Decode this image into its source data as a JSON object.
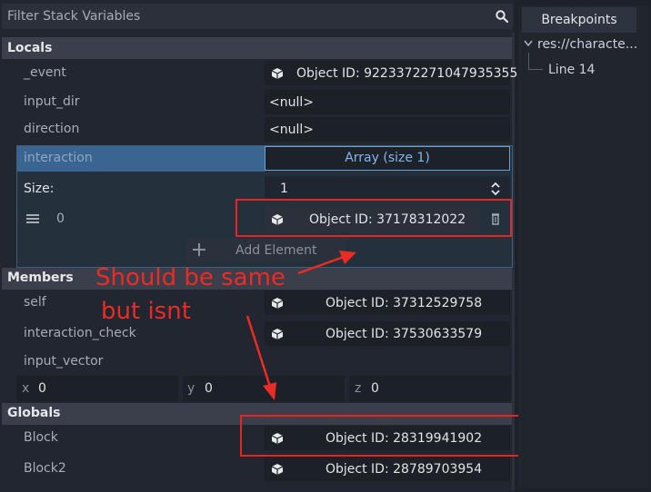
{
  "filter": {
    "placeholder": "Filter Stack Variables",
    "icon": "search-icon"
  },
  "locals": {
    "header": "Locals",
    "event": {
      "label": "_event",
      "value": "Object ID: 9223372271047935355"
    },
    "input_dir": {
      "label": "input_dir",
      "value": "<null>"
    },
    "direction": {
      "label": "direction",
      "value": "<null>"
    },
    "interaction": {
      "label": "interaction",
      "array_button": "Array (size 1)",
      "size_label": "Size:",
      "size_value": "1",
      "element_index": "0",
      "element_value": "Object ID: 37178312022",
      "add_element": "Add Element"
    }
  },
  "members": {
    "header": "Members",
    "self": {
      "label": "self",
      "value": "Object ID: 37312529758"
    },
    "interaction_check": {
      "label": "interaction_check",
      "value": "Object ID: 37530633579"
    },
    "input_vector": {
      "label": "input_vector",
      "x_label": "x",
      "x": "0",
      "y_label": "y",
      "y": "0",
      "z_label": "z",
      "z": "0"
    }
  },
  "globals": {
    "header": "Globals",
    "block": {
      "label": "Block",
      "value": "Object ID: 28319941902"
    },
    "block2": {
      "label": "Block2",
      "value": "Object ID: 28789703954"
    }
  },
  "breakpoints": {
    "tab": "Breakpoints",
    "file": "res://characte...",
    "line": "Line 14"
  },
  "annotation": {
    "line1": "Should be same",
    "line2": "but isnt",
    "color": "#ee2a24"
  }
}
